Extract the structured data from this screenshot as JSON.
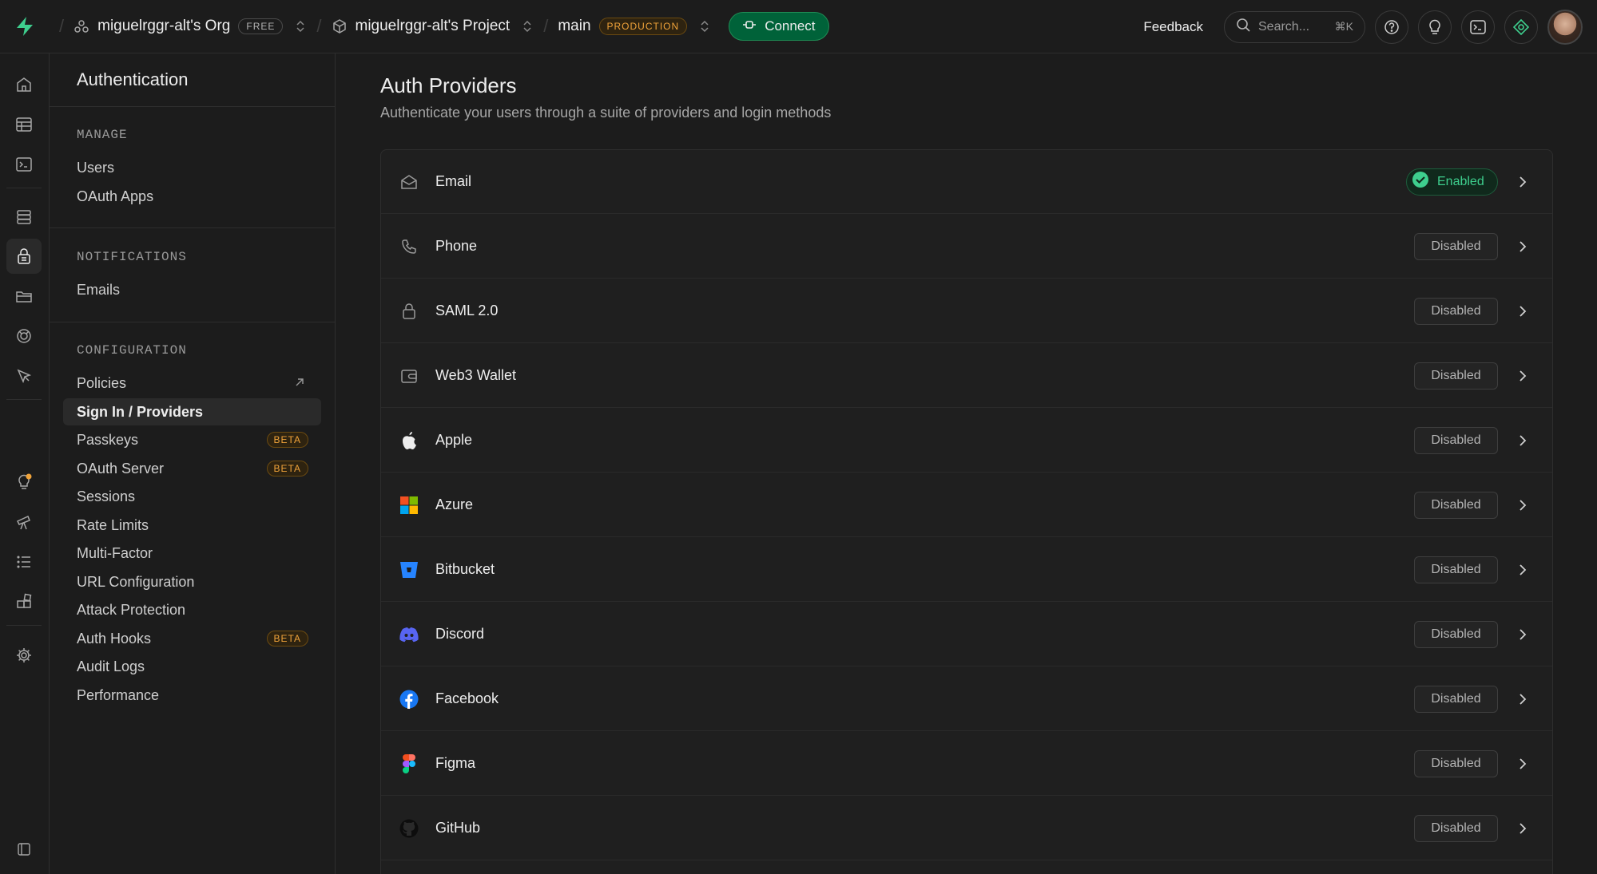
{
  "topbar": {
    "org_name": "miguelrggr-alt's Org",
    "org_plan": "FREE",
    "project_name": "miguelrggr-alt's Project",
    "branch_name": "main",
    "branch_env": "PRODUCTION",
    "connect_label": "Connect",
    "feedback_label": "Feedback",
    "search_placeholder": "Search...",
    "search_shortcut": "⌘K"
  },
  "sidebar": {
    "title": "Authentication",
    "manage_heading": "MANAGE",
    "manage_items": [
      {
        "label": "Users"
      },
      {
        "label": "OAuth Apps"
      }
    ],
    "notifications_heading": "NOTIFICATIONS",
    "notifications_items": [
      {
        "label": "Emails"
      }
    ],
    "configuration_heading": "CONFIGURATION",
    "configuration_items": [
      {
        "label": "Policies",
        "external": true
      },
      {
        "label": "Sign In / Providers",
        "active": true
      },
      {
        "label": "Passkeys",
        "badge": "BETA"
      },
      {
        "label": "OAuth Server",
        "badge": "BETA"
      },
      {
        "label": "Sessions"
      },
      {
        "label": "Rate Limits"
      },
      {
        "label": "Multi-Factor"
      },
      {
        "label": "URL Configuration"
      },
      {
        "label": "Attack Protection"
      },
      {
        "label": "Auth Hooks",
        "badge": "BETA"
      },
      {
        "label": "Audit Logs"
      },
      {
        "label": "Performance"
      }
    ]
  },
  "main": {
    "title": "Auth Providers",
    "subtitle": "Authenticate your users through a suite of providers and login methods",
    "providers": [
      {
        "name": "Email",
        "icon": "mail-icon",
        "status": "Enabled"
      },
      {
        "name": "Phone",
        "icon": "phone-icon",
        "status": "Disabled"
      },
      {
        "name": "SAML 2.0",
        "icon": "lock-icon",
        "status": "Disabled"
      },
      {
        "name": "Web3 Wallet",
        "icon": "wallet-icon",
        "status": "Disabled"
      },
      {
        "name": "Apple",
        "icon": "apple-icon",
        "status": "Disabled"
      },
      {
        "name": "Azure",
        "icon": "azure-icon",
        "status": "Disabled"
      },
      {
        "name": "Bitbucket",
        "icon": "bitbucket-icon",
        "status": "Disabled"
      },
      {
        "name": "Discord",
        "icon": "discord-icon",
        "status": "Disabled"
      },
      {
        "name": "Facebook",
        "icon": "facebook-icon",
        "status": "Disabled"
      },
      {
        "name": "Figma",
        "icon": "figma-icon",
        "status": "Disabled"
      },
      {
        "name": "GitHub",
        "icon": "github-icon",
        "status": "Disabled"
      }
    ]
  },
  "colors": {
    "background": "#1c1c1c",
    "accent_green": "#3ecf8e",
    "connect_bg": "#006239",
    "beta_orange": "#f0a33a"
  }
}
